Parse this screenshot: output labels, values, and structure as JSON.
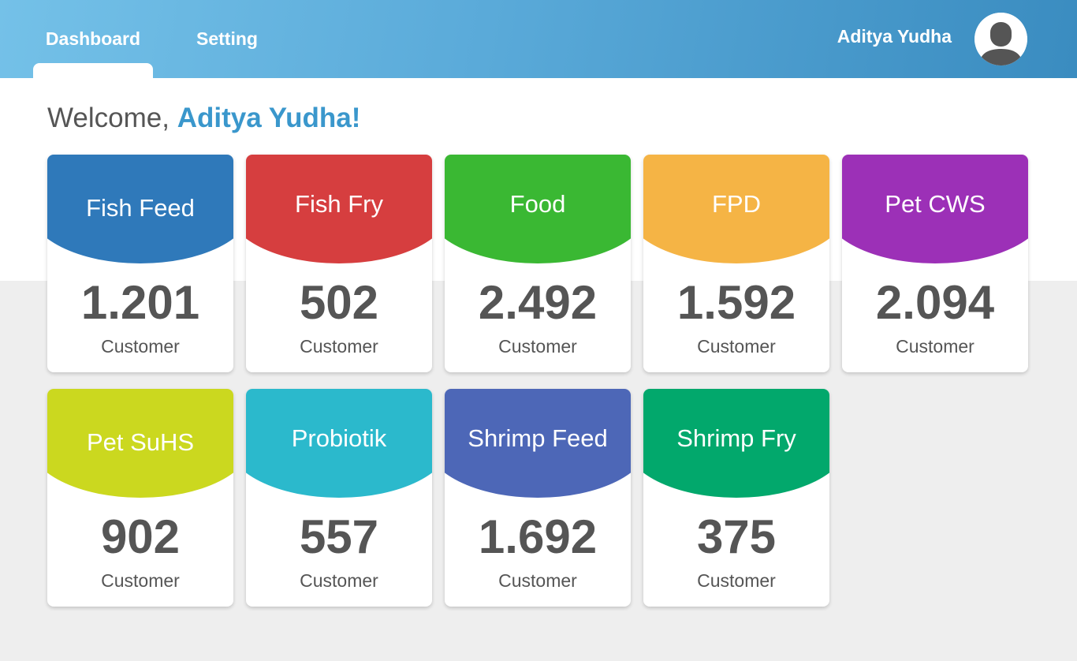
{
  "nav": {
    "tabs": [
      {
        "label": "Dashboard",
        "active": true
      },
      {
        "label": "Setting",
        "active": false
      }
    ]
  },
  "user": {
    "name": "Aditya Yudha",
    "avatar_icon": "user-avatar-icon"
  },
  "welcome": {
    "prefix": "Welcome, ",
    "name": "Aditya Yudha!"
  },
  "cards": [
    {
      "title": "Fish Feed",
      "value": "1.201",
      "unit": "Customer",
      "color": "#2f79ba"
    },
    {
      "title": "Fish Fry",
      "value": "502",
      "unit": "Customer",
      "color": "#d63e3f"
    },
    {
      "title": "Food",
      "value": "2.492",
      "unit": "Customer",
      "color": "#3ab833"
    },
    {
      "title": "FPD",
      "value": "1.592",
      "unit": "Customer",
      "color": "#f5b445"
    },
    {
      "title": "Pet CWS",
      "value": "2.094",
      "unit": "Customer",
      "color": "#9c30b7"
    },
    {
      "title": "Pet SuHS",
      "value": "902",
      "unit": "Customer",
      "color": "#cbd81f"
    },
    {
      "title": "Probiotik",
      "value": "557",
      "unit": "Customer",
      "color": "#2bb9cc"
    },
    {
      "title": "Shrimp Feed",
      "value": "1.692",
      "unit": "Customer",
      "color": "#4d67b7"
    },
    {
      "title": "Shrimp Fry",
      "value": "375",
      "unit": "Customer",
      "color": "#02a86c"
    }
  ],
  "colors": {
    "header_start": "#74c1e8",
    "header_end": "#3a8cc0",
    "accent": "#3a97cc",
    "text": "#555555",
    "background": "#eeeeee"
  }
}
